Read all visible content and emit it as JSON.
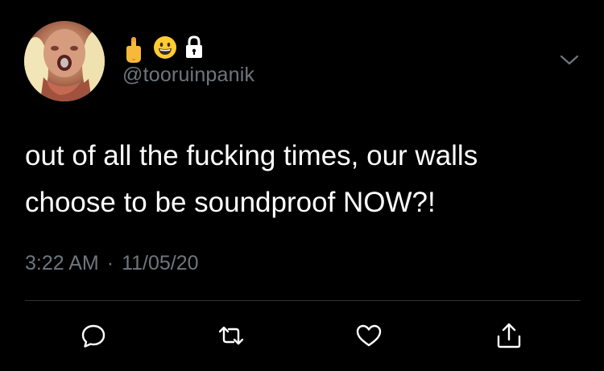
{
  "tweet": {
    "handle": "@tooruinpanik",
    "name_emojis": [
      "middle-finger-emoji",
      "grinning-face-emoji",
      "lock-icon"
    ],
    "text_lines": [
      "out of all the fucking times, our walls",
      "choose to be soundproof NOW?!"
    ],
    "time": "3:22 AM",
    "separator": "·",
    "date": "11/05/20"
  },
  "actions": [
    "reply-icon",
    "retweet-icon",
    "like-icon",
    "share-icon"
  ],
  "colors": {
    "background": "#000000",
    "text": "#ffffff",
    "secondary": "#6e767d",
    "divider": "#2f3336",
    "emoji_yellow": "#ffcc33"
  }
}
